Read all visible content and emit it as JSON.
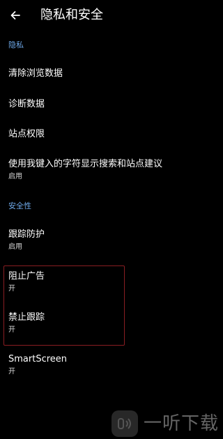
{
  "app_bar": {
    "title": "隐私和安全",
    "back_icon": "arrow-left-icon"
  },
  "sections": {
    "privacy": {
      "header": "隐私",
      "items": [
        {
          "title": "清除浏览数据"
        },
        {
          "title": "诊断数据"
        },
        {
          "title": "站点权限"
        },
        {
          "title": "使用我键入的字符显示搜索和站点建议",
          "subtitle": "启用"
        }
      ]
    },
    "security": {
      "header": "安全性",
      "items": [
        {
          "title": "跟踪防护",
          "subtitle": "启用"
        },
        {
          "title": "阻止广告",
          "subtitle": "开"
        },
        {
          "title": "禁止跟踪",
          "subtitle": "开"
        },
        {
          "title": "SmartScreen",
          "subtitle": "开"
        }
      ]
    }
  },
  "colors": {
    "background": "#000000",
    "section_header": "#6ea8e8",
    "highlight_border": "#8a1d22"
  },
  "watermark": {
    "text": "一听下载",
    "icon": "watermark-logo-icon"
  }
}
